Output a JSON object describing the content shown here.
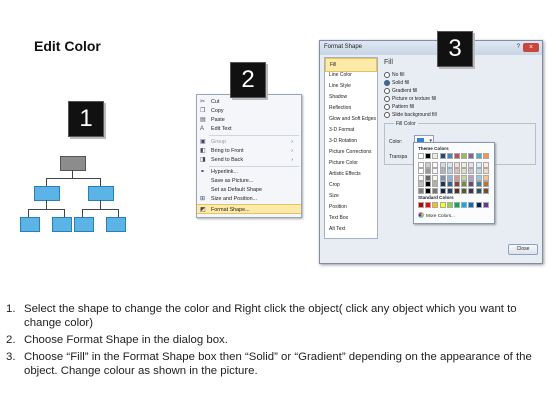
{
  "title": "Edit Color",
  "badges": [
    "1",
    "2",
    "3"
  ],
  "context_menu": {
    "items": [
      {
        "label": "Cut",
        "icon": "scissors-icon",
        "glyph": "✂"
      },
      {
        "label": "Copy",
        "icon": "copy-icon",
        "glyph": "❐"
      },
      {
        "label": "Paste",
        "icon": "paste-icon",
        "glyph": "▤"
      },
      {
        "label": "Edit Text",
        "icon": "edit-text-icon",
        "glyph": "A"
      },
      {
        "label": "Group",
        "icon": "group-icon",
        "glyph": "▣"
      },
      {
        "label": "Bring to Front",
        "icon": "bring-front-icon",
        "glyph": "◧"
      },
      {
        "label": "Send to Back",
        "icon": "send-back-icon",
        "glyph": "◨"
      },
      {
        "label": "Hyperlink...",
        "icon": "hyperlink-icon",
        "glyph": "⚭"
      },
      {
        "label": "Save as Picture...",
        "icon": "",
        "glyph": ""
      },
      {
        "label": "Set as Default Shape",
        "icon": "",
        "glyph": ""
      },
      {
        "label": "Size and Position...",
        "icon": "size-position-icon",
        "glyph": "⊞"
      },
      {
        "label": "Format Shape...",
        "icon": "format-shape-icon",
        "glyph": "◩"
      }
    ]
  },
  "dialog": {
    "title": "Format Shape",
    "help": "?",
    "close_glyph": "×",
    "categories": [
      "Fill",
      "Line Color",
      "Line Style",
      "Shadow",
      "Reflection",
      "Glow and Soft Edges",
      "3-D Format",
      "3-D Rotation",
      "Picture Corrections",
      "Picture Color",
      "Artistic Effects",
      "Crop",
      "Size",
      "Position",
      "Text Box",
      "Alt Text"
    ],
    "fill_heading": "Fill",
    "fill_options": [
      "No fill",
      "Solid fill",
      "Gradient fill",
      "Picture or texture fill",
      "Pattern fill",
      "Slide background fill"
    ],
    "selected_fill": "Solid fill",
    "fill_color_group": "Fill Color",
    "color_label": "Color:",
    "transparency_label": "Transpa",
    "close_button": "Close"
  },
  "palette": {
    "theme_heading": "Theme Colors",
    "standard_heading": "Standard Colors",
    "more": "More Colors...",
    "theme_colors": [
      "#ffffff",
      "#000000",
      "#eeece1",
      "#1f497d",
      "#4f81bd",
      "#c0504d",
      "#9bbb59",
      "#8064a2",
      "#4bacc6",
      "#f79646"
    ],
    "standard_colors": [
      "#c00000",
      "#ff0000",
      "#ffc000",
      "#ffff00",
      "#92d050",
      "#00b050",
      "#00b0f0",
      "#0070c0",
      "#002060",
      "#7030a0"
    ]
  },
  "instructions": [
    {
      "num": "1.",
      "text": "Select the shape to change the color and Right click the object( click any object which you want to change color)"
    },
    {
      "num": "2.",
      "text": "Choose Format Shape in the dialog box."
    },
    {
      "num": "3.",
      "text": "Choose “Fill” in the Format Shape box then “Solid” or “Gradient” depending on the appearance of the object. Change colour as shown in the picture."
    }
  ]
}
